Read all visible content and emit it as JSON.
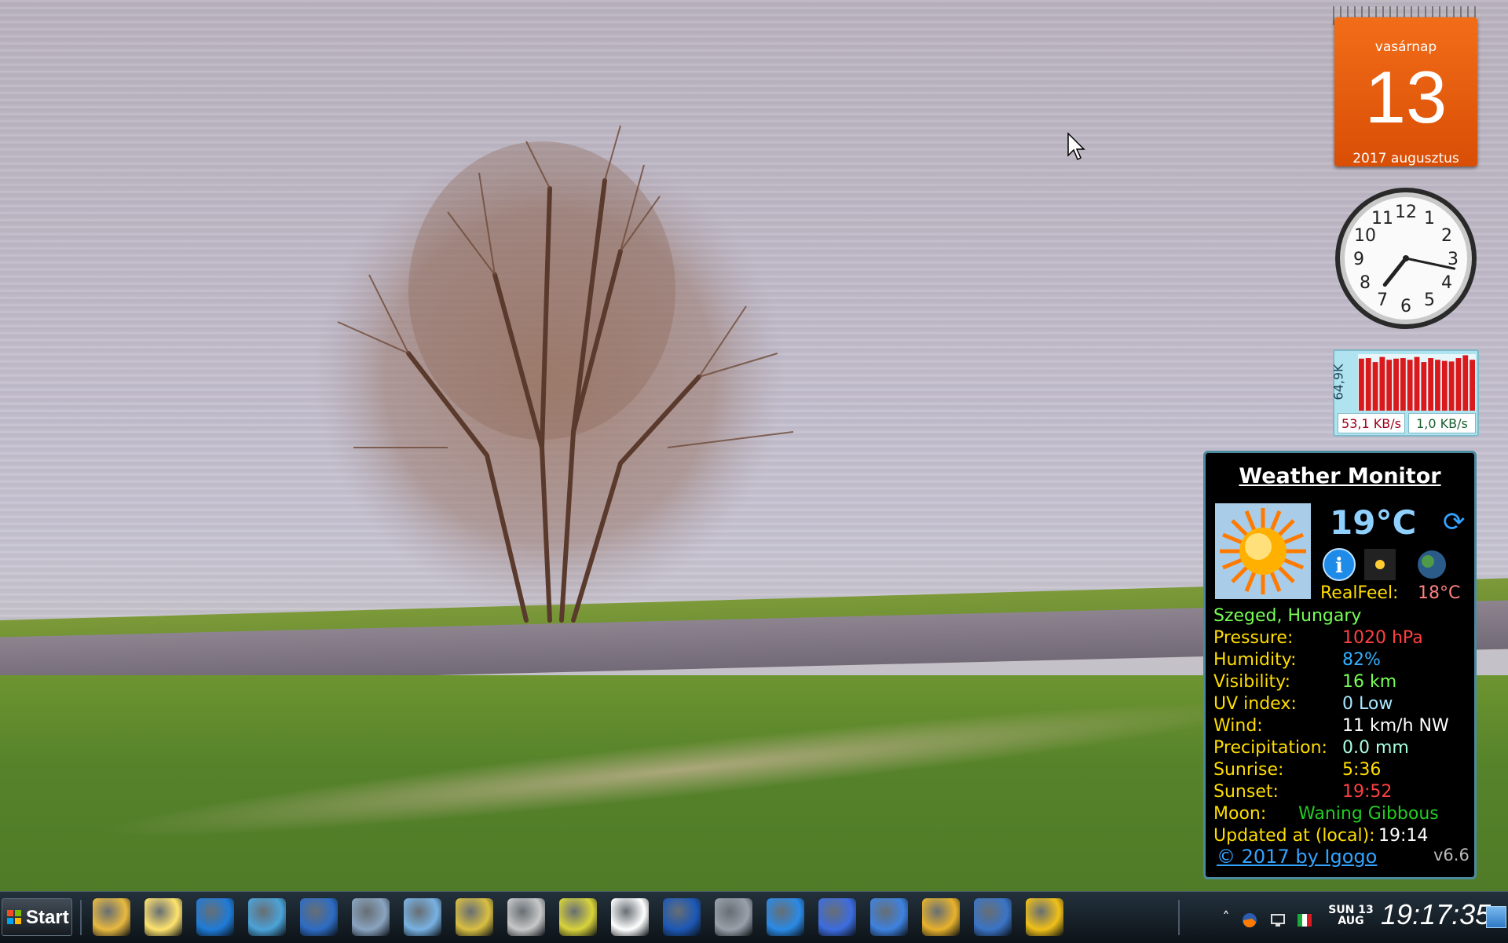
{
  "calendar": {
    "weekday": "vasárnap",
    "day": "13",
    "month_year": "2017 augusztus"
  },
  "clock": {
    "numerals": [
      "12",
      "1",
      "2",
      "3",
      "4",
      "5",
      "6",
      "7",
      "8",
      "9",
      "10",
      "11"
    ],
    "hour": 19,
    "minute": 17
  },
  "network": {
    "scale": "64,9K",
    "download": "53,1 KB/s",
    "upload": "1,0 KB/s",
    "bar_levels": [
      0.92,
      0.93,
      0.86,
      0.95,
      0.9,
      0.92,
      0.93,
      0.9,
      0.95,
      0.86,
      0.93,
      0.9,
      0.88,
      0.87,
      0.93,
      0.98,
      0.9
    ]
  },
  "weather": {
    "title": "Weather Monitor",
    "temperature": "19°C",
    "realfeel_label": "RealFeel:",
    "realfeel_value": "18°C",
    "location": "Szeged, Hungary",
    "rows": [
      {
        "label": "Pressure:",
        "value": "1020 hPa",
        "color": "#ff4040"
      },
      {
        "label": "Humidity:",
        "value": "82%",
        "color": "#33b0ff"
      },
      {
        "label": "Visibility:",
        "value": "16 km",
        "color": "#77ff55"
      },
      {
        "label": "UV index:",
        "value": "0 Low",
        "color": "#a8e8ff"
      },
      {
        "label": "Wind:",
        "value": "11 km/h NW",
        "color": "#ffffff"
      },
      {
        "label": "Precipitation:",
        "value": "0.0 mm",
        "color": "#a8ffe0"
      },
      {
        "label": "Sunrise:",
        "value": "5:36",
        "color": "#ffdd00"
      },
      {
        "label": "Sunset:",
        "value": "19:52",
        "color": "#ff4040"
      }
    ],
    "moon_label": "Moon:",
    "moon_value": "Waning Gibbous",
    "moon_color": "#22cc22",
    "updated_label": "Updated at (local):",
    "updated_value": "19:14",
    "copyright": "© 2017 by Igogo",
    "version": "v6.6"
  },
  "taskbar": {
    "start_label": "Start",
    "icons": [
      {
        "name": "file-explorer-icon",
        "color": "#e8b940"
      },
      {
        "name": "sticky-notes-icon",
        "color": "#ffe36e"
      },
      {
        "name": "favorites-heart-icon",
        "color": "#1e7bd8"
      },
      {
        "name": "weather-app-icon",
        "color": "#4ba3d8"
      },
      {
        "name": "card-app-icon",
        "color": "#2d6cc4"
      },
      {
        "name": "computer-tools-icon",
        "color": "#8aa4c0"
      },
      {
        "name": "network-settings-icon",
        "color": "#78b2e2"
      },
      {
        "name": "search-magnifier-icon",
        "color": "#d9bf42"
      },
      {
        "name": "help-tools-icon",
        "color": "#c8c8c8"
      },
      {
        "name": "disc-player-icon",
        "color": "#d9d43c"
      },
      {
        "name": "fox-mask-icon",
        "color": "#ffffff"
      },
      {
        "name": "floppy-save-icon",
        "color": "#1c58b6"
      },
      {
        "name": "mp3-media-icon",
        "color": "#9aa0aa"
      },
      {
        "name": "play-arrow-icon",
        "color": "#2a8ae6"
      },
      {
        "name": "books-library-icon",
        "color": "#3c6ce0"
      },
      {
        "name": "sync-refresh-icon",
        "color": "#3e82e0"
      },
      {
        "name": "globe-app-icon",
        "color": "#e8b22c"
      },
      {
        "name": "thunderbird-mail-icon",
        "color": "#3a74c6"
      },
      {
        "name": "pizza-slice-icon",
        "color": "#f0c018"
      }
    ],
    "tray_chevron": "˄",
    "date_weekday": "SUN",
    "date_day": "13",
    "date_month": "AUG",
    "time": "19:17:35"
  }
}
